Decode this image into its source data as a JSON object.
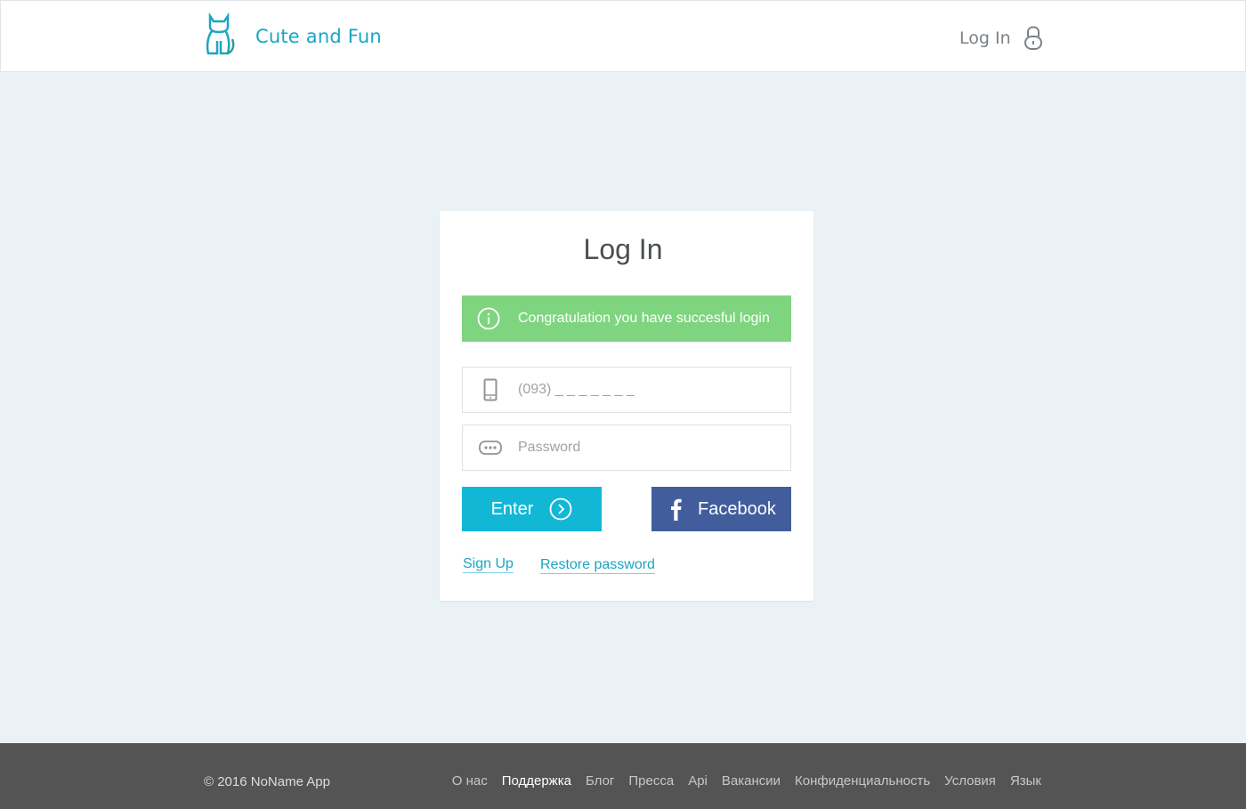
{
  "header": {
    "brand": "Cute and Fun",
    "login_label": "Log In"
  },
  "login_card": {
    "title": "Log In",
    "alert_message": "Congratulation you have succesful login",
    "phone_placeholder": "(093) _ _ _ _ _ _ _",
    "password_placeholder": "Password",
    "enter_label": "Enter",
    "facebook_label": "Facebook",
    "signup_label": "Sign Up",
    "restore_label": "Restore password"
  },
  "footer": {
    "copyright": "© 2016 NoName App",
    "links": [
      "О нас",
      "Поддержка",
      "Блог",
      "Пресса",
      "Api",
      "Вакансии",
      "Конфиденциальность",
      "Условия",
      "Язык"
    ]
  },
  "colors": {
    "brand": "#1aa5c3",
    "success": "#7fd57f",
    "enter_button": "#13b7d6",
    "facebook_button": "#415d9c",
    "footer_bg": "#545454",
    "page_bg": "#eaf2f5"
  },
  "icons": {
    "logo": "cat-logo-icon",
    "header_login": "lock-icon",
    "alert": "info-icon",
    "phone": "phone-icon",
    "password": "password-dots-icon",
    "enter": "chevron-right-circle-icon",
    "facebook": "facebook-icon"
  }
}
